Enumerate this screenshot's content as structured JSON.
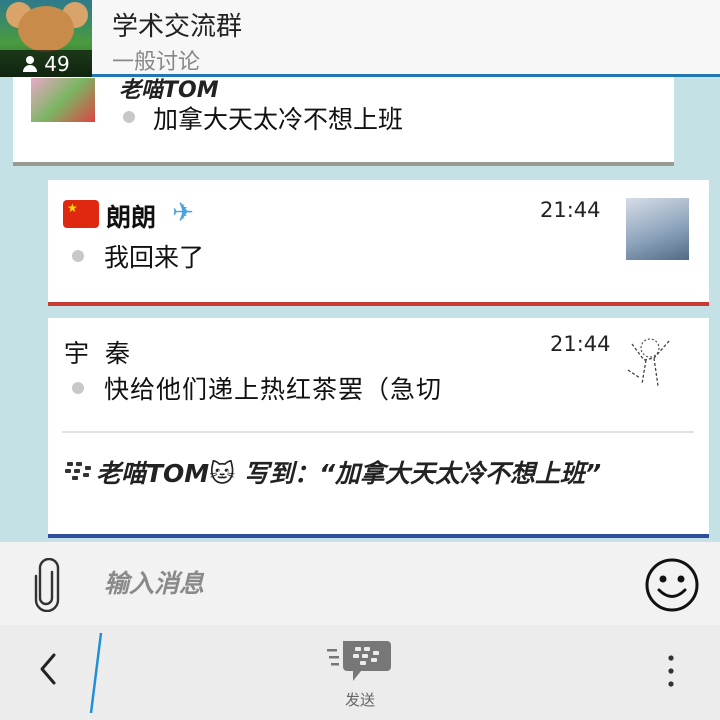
{
  "header": {
    "title": "学术交流群",
    "subtitle": "一般讨论",
    "member_count": "49"
  },
  "messages": [
    {
      "partial_sender": "老喵TOM",
      "text": "加拿大天太冷不想上班"
    },
    {
      "sender": "朗朗",
      "time": "21:44",
      "text": "我回来了",
      "accent_color": "#c83a34"
    },
    {
      "sender": "宇 秦",
      "time": "21:44",
      "text": "快给他们递上热红茶罢（急切",
      "quote": "老喵TOM🐱 写到：“加拿大天太冷不想上班”",
      "accent_color": "#2f4f9b"
    }
  ],
  "composer": {
    "placeholder": "输入消息"
  },
  "bottom": {
    "send_label": "发送"
  },
  "colors": {
    "background": "#c4e1e5",
    "header_accent": "#1f78b4"
  }
}
